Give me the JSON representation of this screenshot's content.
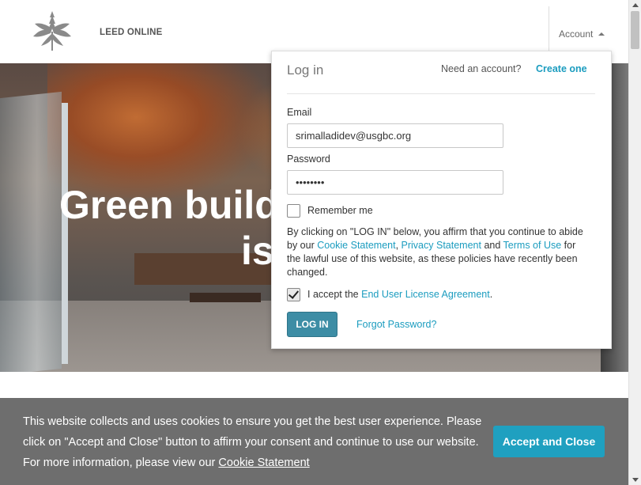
{
  "header": {
    "brand": "LEED ONLINE",
    "account_label": "Account"
  },
  "hero": {
    "title_line1": "Green build",
    "title_line2": "is"
  },
  "login": {
    "title": "Log in",
    "need_account": "Need an account?",
    "create_link": "Create one",
    "email_label": "Email",
    "email_value": "srimalladidev@usgbc.org",
    "password_label": "Password",
    "password_value": "••••••••",
    "remember_label": "Remember me",
    "remember_checked": false,
    "terms": {
      "part1": "By clicking on \"LOG IN\" below, you affirm that you continue to abide by our ",
      "cookie_link": "Cookie Statement",
      "sep1": ", ",
      "privacy_link": "Privacy Statement",
      "sep2": " and ",
      "terms_link": "Terms of Use",
      "part2": " for the lawful use of this website, as these policies have recently been changed."
    },
    "eula_prefix": "I accept the ",
    "eula_link": "End User License Agreement",
    "eula_suffix": ".",
    "eula_checked": true,
    "login_button": "LOG IN",
    "forgot_link": "Forgot Password?"
  },
  "cookie_banner": {
    "text": "This website collects and uses cookies to ensure you get the best user experience. Please click on \"Accept and Close\" button to affirm your consent and continue to use our website. For more information, please view our ",
    "link": "Cookie Statement",
    "button": "Accept and Close"
  },
  "colors": {
    "accent": "#1b9cbf",
    "login_button": "#3d8da5",
    "cookie_bg": "#6e6e6e",
    "cookie_button": "#1fa0c0"
  }
}
